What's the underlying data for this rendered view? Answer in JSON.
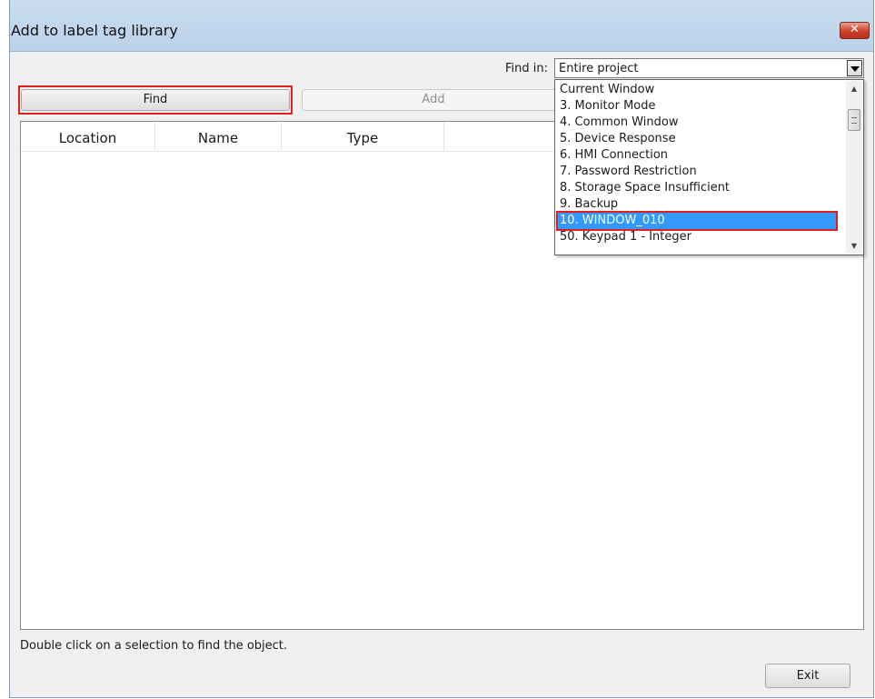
{
  "window": {
    "title": "Add to label tag library",
    "close_glyph": "✕"
  },
  "find_in": {
    "label": "Find in:",
    "value": "Entire project"
  },
  "dropdown": {
    "options": [
      "Current Window",
      "3. Monitor Mode",
      "4. Common Window",
      "5. Device Response",
      "6. HMI Connection",
      "7. Password Restriction",
      "8. Storage Space Insufficient",
      "9. Backup",
      "10. WINDOW_010",
      "50. Keypad 1 - Integer"
    ],
    "selected": "10. WINDOW_010",
    "scroll_up_glyph": "▲",
    "scroll_down_glyph": "▼"
  },
  "toolbar": {
    "find_label": "Find",
    "add_label": "Add"
  },
  "results": {
    "columns": [
      "Location",
      "Name",
      "Type"
    ]
  },
  "status": {
    "hint": "Double click on a selection to find the object."
  },
  "footer": {
    "exit_label": "Exit"
  },
  "colors": {
    "titlebar": "#c9dcf0",
    "highlight_border": "#e02020",
    "selection": "#3399ff",
    "close_button": "#c9412b"
  },
  "icons": [
    "close-icon",
    "dropdown-arrow-icon",
    "scroll-up-icon",
    "scroll-down-icon"
  ]
}
